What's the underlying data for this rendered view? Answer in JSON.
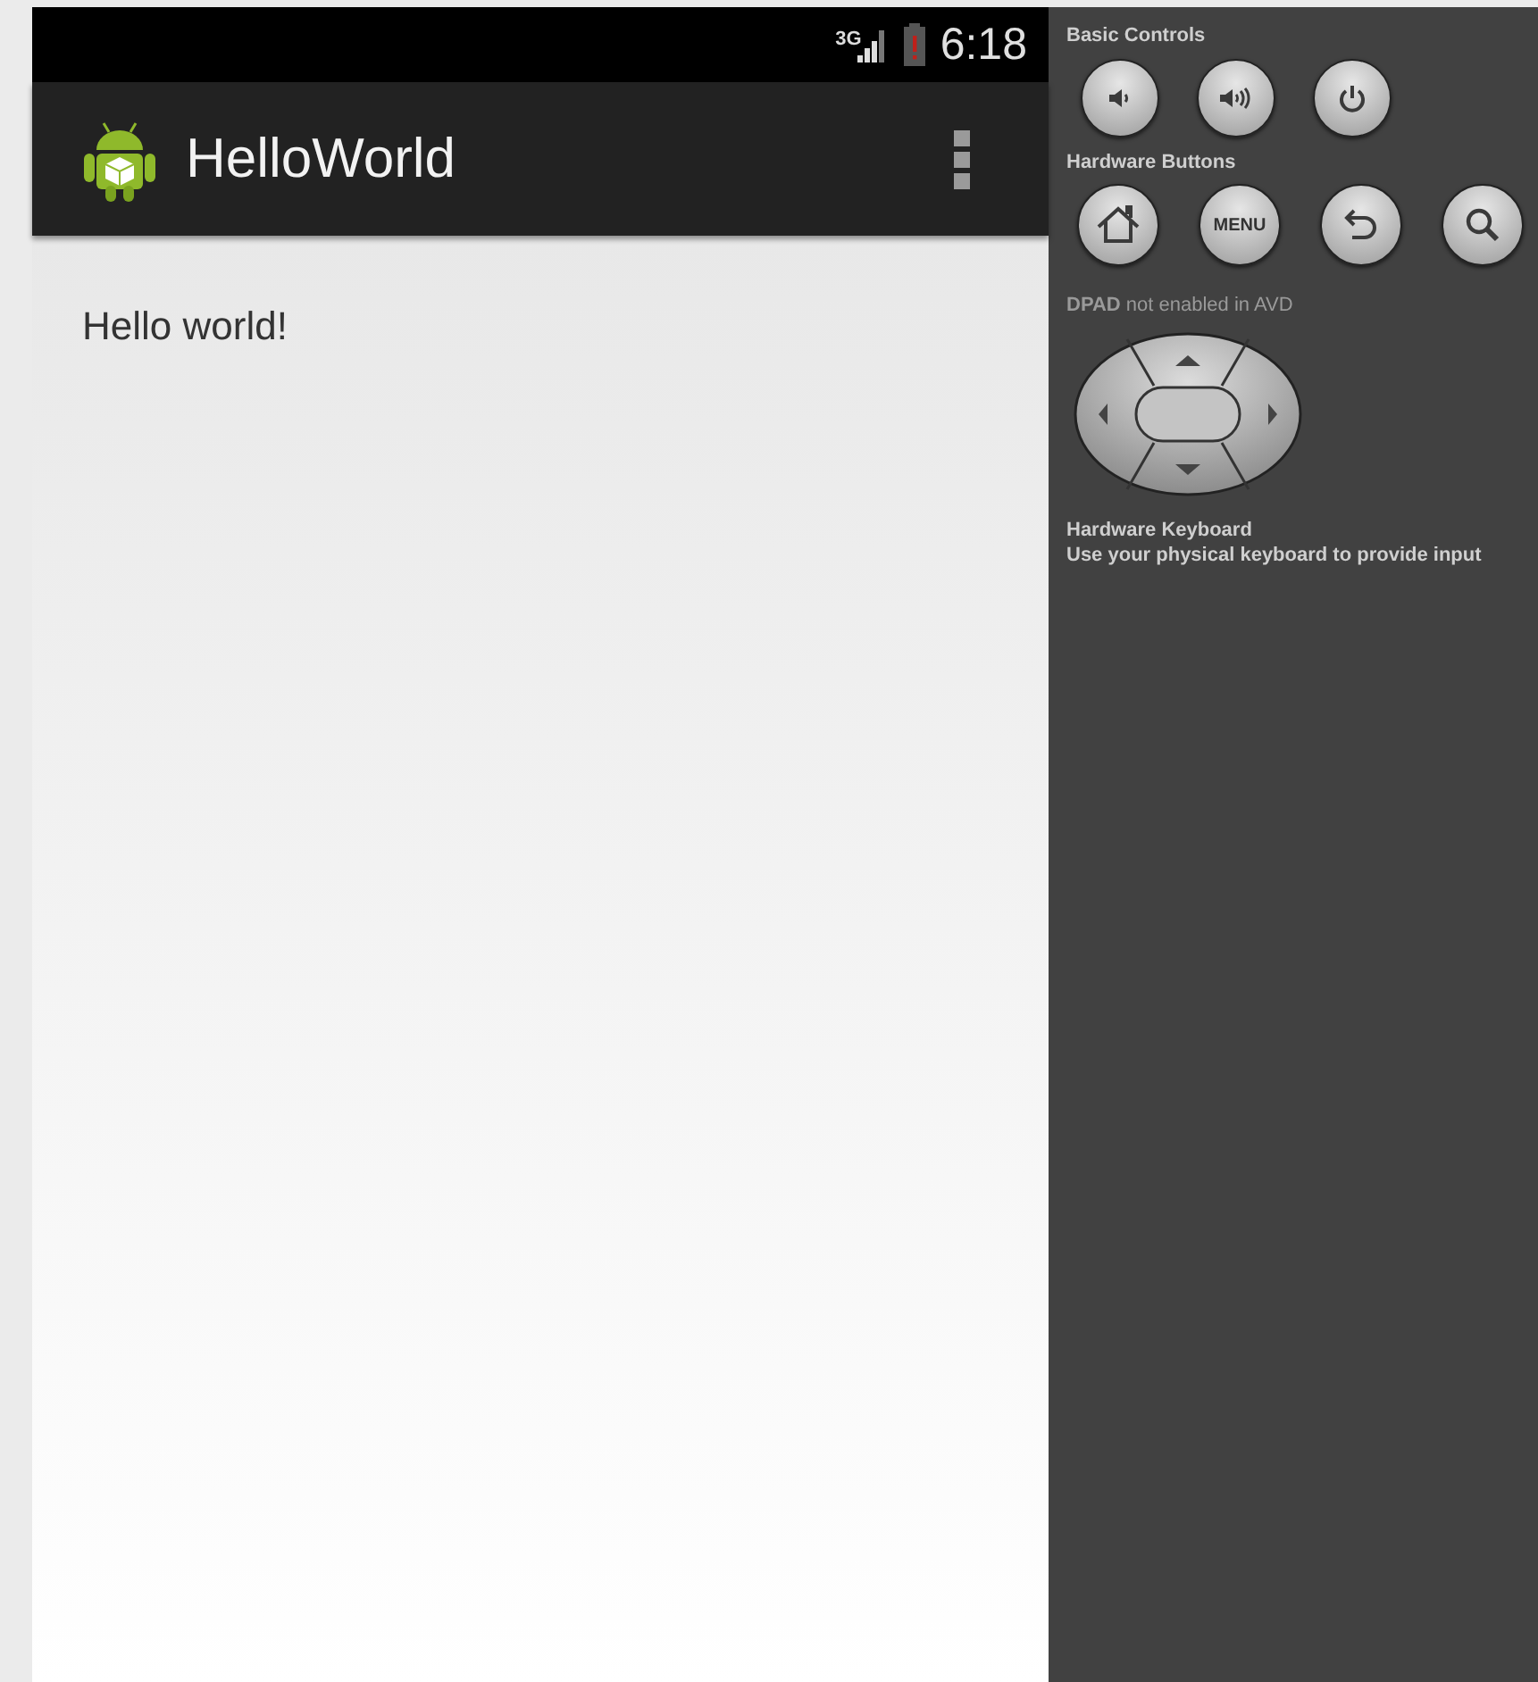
{
  "status_bar": {
    "network": "3G",
    "time": "6:18"
  },
  "action_bar": {
    "title": "HelloWorld"
  },
  "content": {
    "text": "Hello world!"
  },
  "controls_panel": {
    "sections": [
      {
        "kind": "buttons",
        "title": "Basic Controls",
        "buttons": [
          {
            "kind": "volume_down"
          },
          {
            "kind": "volume_up"
          },
          {
            "kind": "power"
          }
        ]
      },
      {
        "kind": "buttons",
        "title": "Hardware Buttons",
        "buttons": [
          {
            "kind": "home"
          },
          {
            "kind": "text",
            "label": "MENU"
          },
          {
            "kind": "back"
          },
          {
            "kind": "search"
          }
        ]
      },
      {
        "kind": "dpad",
        "title": "**DPAD** not enabled in AVD"
      },
      {
        "kind": "info",
        "title": "Hardware Keyboard",
        "text": "Use your physical keyboard to provide input"
      }
    ]
  }
}
